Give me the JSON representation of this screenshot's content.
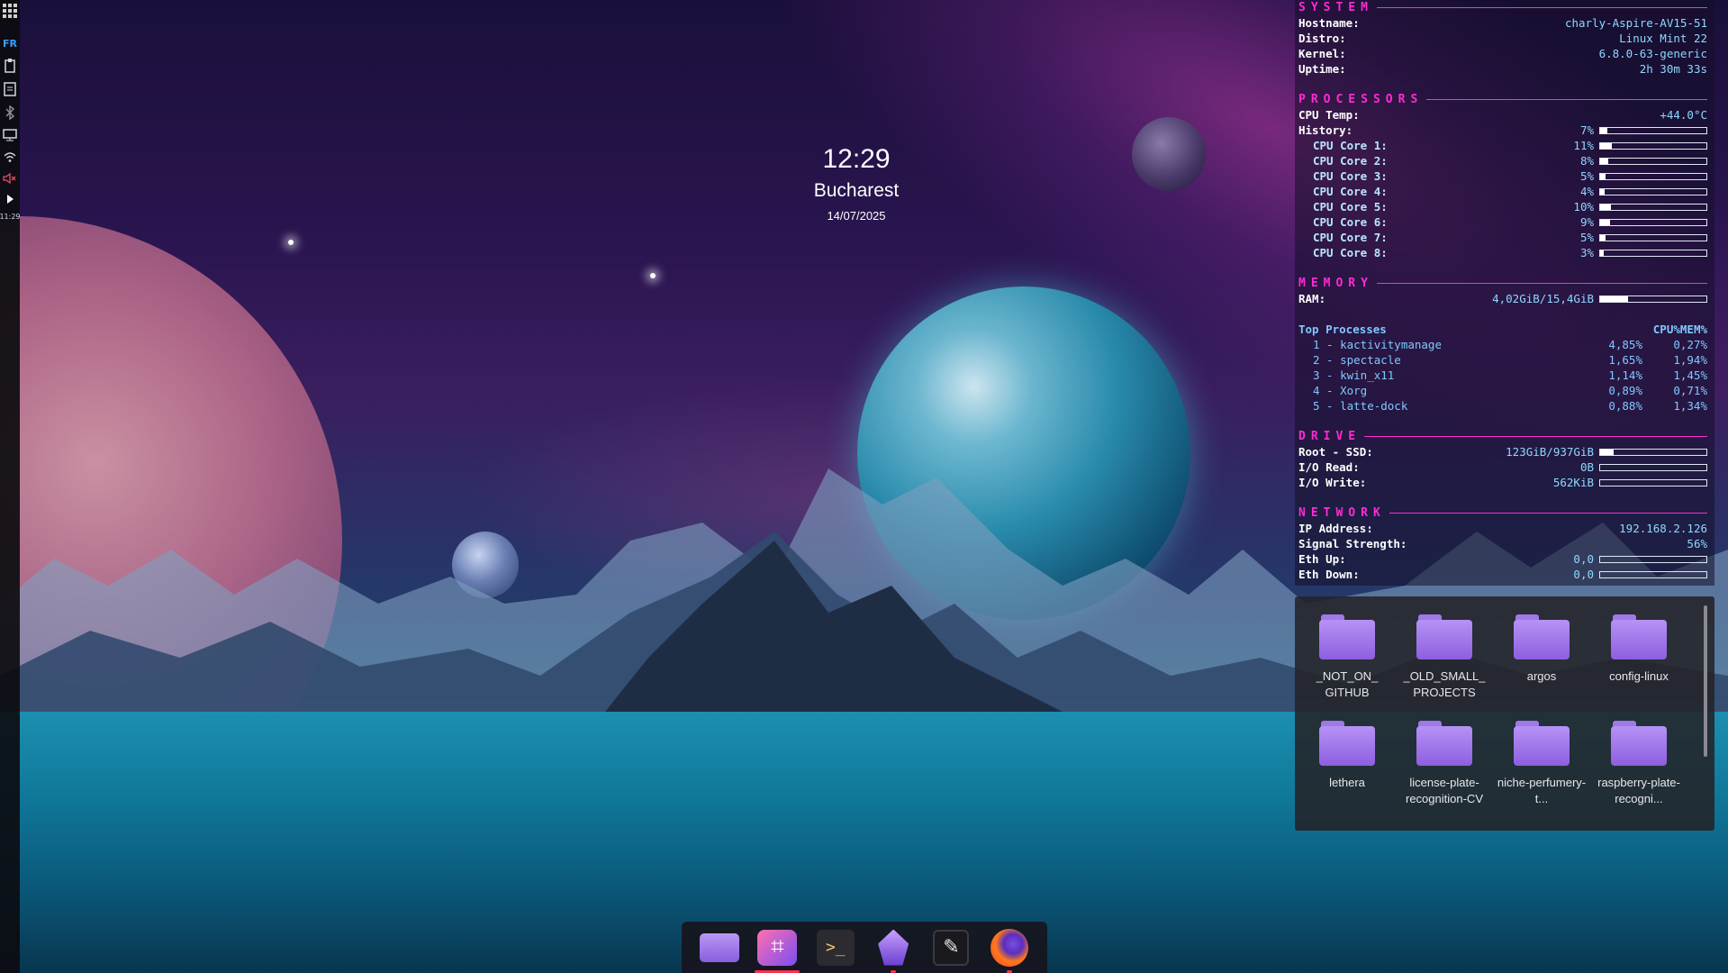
{
  "left_panel": {
    "lang": "FR",
    "time": "11:29"
  },
  "clock": {
    "time": "12:29",
    "city": "Bucharest",
    "date": "14/07/2025"
  },
  "conky": {
    "system": {
      "title": "SYSTEM",
      "rows": [
        {
          "k": "Hostname:",
          "v": "charly-Aspire-AV15-51"
        },
        {
          "k": "Distro:",
          "v": "Linux Mint 22"
        },
        {
          "k": "Kernel:",
          "v": "6.8.0-63-generic"
        },
        {
          "k": "Uptime:",
          "v": "2h 30m 33s"
        }
      ]
    },
    "processors": {
      "title": "PROCESSORS",
      "temp_label": "CPU Temp:",
      "temp_value": "+44.0°C",
      "history_label": "History:",
      "history_pct": "7%",
      "history_fill": 0.07,
      "cores": [
        {
          "k": "CPU Core 1:",
          "pct": "11%",
          "fill": 0.11
        },
        {
          "k": "CPU Core 2:",
          "pct": "8%",
          "fill": 0.08
        },
        {
          "k": "CPU Core 3:",
          "pct": "5%",
          "fill": 0.05
        },
        {
          "k": "CPU Core 4:",
          "pct": "4%",
          "fill": 0.04
        },
        {
          "k": "CPU Core 5:",
          "pct": "10%",
          "fill": 0.1
        },
        {
          "k": "CPU Core 6:",
          "pct": "9%",
          "fill": 0.09
        },
        {
          "k": "CPU Core 7:",
          "pct": "5%",
          "fill": 0.05
        },
        {
          "k": "CPU Core 8:",
          "pct": "3%",
          "fill": 0.03
        }
      ]
    },
    "memory": {
      "title": "MEMORY",
      "ram_label": "RAM:",
      "ram_value": "4,02GiB/15,4GiB",
      "ram_fill": 0.26,
      "top_label": "Top Processes",
      "cpu_head": "CPU%",
      "mem_head": "MEM%",
      "procs": [
        {
          "name": "1 - kactivitymanage",
          "cpu": "4,85%",
          "mem": "0,27%"
        },
        {
          "name": "2 - spectacle",
          "cpu": "1,65%",
          "mem": "1,94%"
        },
        {
          "name": "3 - kwin_x11",
          "cpu": "1,14%",
          "mem": "1,45%"
        },
        {
          "name": "4 - Xorg",
          "cpu": "0,89%",
          "mem": "0,71%"
        },
        {
          "name": "5 - latte-dock",
          "cpu": "0,88%",
          "mem": "1,34%"
        }
      ]
    },
    "drive": {
      "title": "DRIVE",
      "rows": [
        {
          "k": "Root - SSD:",
          "v": "123GiB/937GiB",
          "fill": 0.13
        },
        {
          "k": "I/O Read:",
          "v": "0B",
          "fill": 0
        },
        {
          "k": "I/O Write:",
          "v": "562KiB",
          "fill": 0
        }
      ]
    },
    "network": {
      "title": "NETWORK",
      "ip_label": "IP Address:",
      "ip_value": "192.168.2.126",
      "signal_label": "Signal Strength:",
      "signal_value": "56%",
      "up_label": "Eth Up:",
      "up_value": "0,0",
      "down_label": "Eth Down:",
      "down_value": "0,0"
    }
  },
  "folders": [
    {
      "label": "_NOT_ON_ GITHUB"
    },
    {
      "label": "_OLD_SMALL_ PROJECTS"
    },
    {
      "label": "argos"
    },
    {
      "label": "config-linux"
    },
    {
      "label": "lethera"
    },
    {
      "label": "license-plate-recognition-CV"
    },
    {
      "label": "niche-perfumery-t..."
    },
    {
      "label": "raspberry-plate-recogni..."
    }
  ],
  "dock": {
    "items": [
      "file-manager-icon",
      "crop-tool-icon",
      "terminal-icon",
      "obsidian-icon",
      "text-editor-icon",
      "firefox-icon"
    ]
  }
}
